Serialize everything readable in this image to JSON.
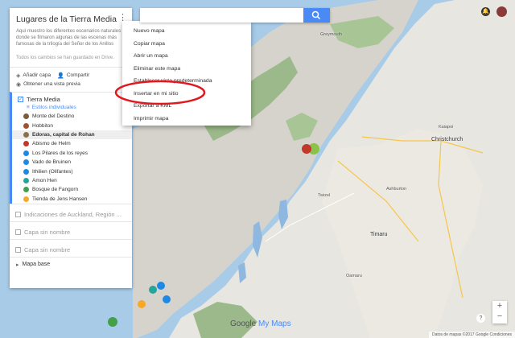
{
  "map_name": "Lugares de la Tierra Media",
  "description": "Aquí muestro los diferentes escenarios naturales donde se filmaron algunas de las escenas más famosas de la trilogía del Señor de los Anillos",
  "save_status": "Todos los cambios se han guardado en Drive.",
  "actions": {
    "add_layer": "Añadir capa",
    "share": "Compartir",
    "preview": "Obtener una vista previa"
  },
  "layer": {
    "name": "Tierra Media",
    "styles_label": "Estilos individuales",
    "places": [
      {
        "label": "Monte del Destino",
        "color": "#7c5a3a"
      },
      {
        "label": "Hobbiton",
        "color": "#a0522d"
      },
      {
        "label": "Edoras, capital de Rohan",
        "color": "#8d6e4a"
      },
      {
        "label": "Abismo de Helm",
        "color": "#c0392b"
      },
      {
        "label": "Los Pilares de los reyes",
        "color": "#1e88e5"
      },
      {
        "label": "Vado de Bruinen",
        "color": "#1e88e5"
      },
      {
        "label": "Ithilien (Olifantes)",
        "color": "#1e88e5"
      },
      {
        "label": "Amon Hen",
        "color": "#26a69a"
      },
      {
        "label": "Bosque de Fangorn",
        "color": "#43a047"
      },
      {
        "label": "Tienda de Jens Hansen",
        "color": "#f9a825"
      }
    ]
  },
  "other_layers": [
    "Indicaciones de Auckland, Región ...",
    "Capa sin nombre",
    "Capa sin nombre"
  ],
  "base_map": "Mapa base",
  "menu": [
    "Nuevo mapa",
    "Copiar mapa",
    "Abrir un mapa",
    "Eliminar este mapa",
    "Establecer vista predeterminada",
    "Insertar en mi sitio",
    "Exportar a KML",
    "Imprimir mapa"
  ],
  "search": {
    "value": ""
  },
  "cities": [
    {
      "name": "Christchurch",
      "cls": ""
    },
    {
      "name": "Timaru",
      "cls": ""
    },
    {
      "name": "Greymouth",
      "cls": "small"
    },
    {
      "name": "Twizel",
      "cls": "small"
    },
    {
      "name": "Kaiapoi",
      "cls": "small"
    },
    {
      "name": "Ashburton",
      "cls": "small"
    },
    {
      "name": "Oamaru",
      "cls": "small"
    }
  ],
  "branding": {
    "google": "Google",
    "mymaps": "My Maps"
  },
  "attribution": "Datos de mapas ©2017 Google    Condiciones",
  "colors": {
    "accent": "#4a8af4",
    "highlight_circle": "#e0191f"
  }
}
